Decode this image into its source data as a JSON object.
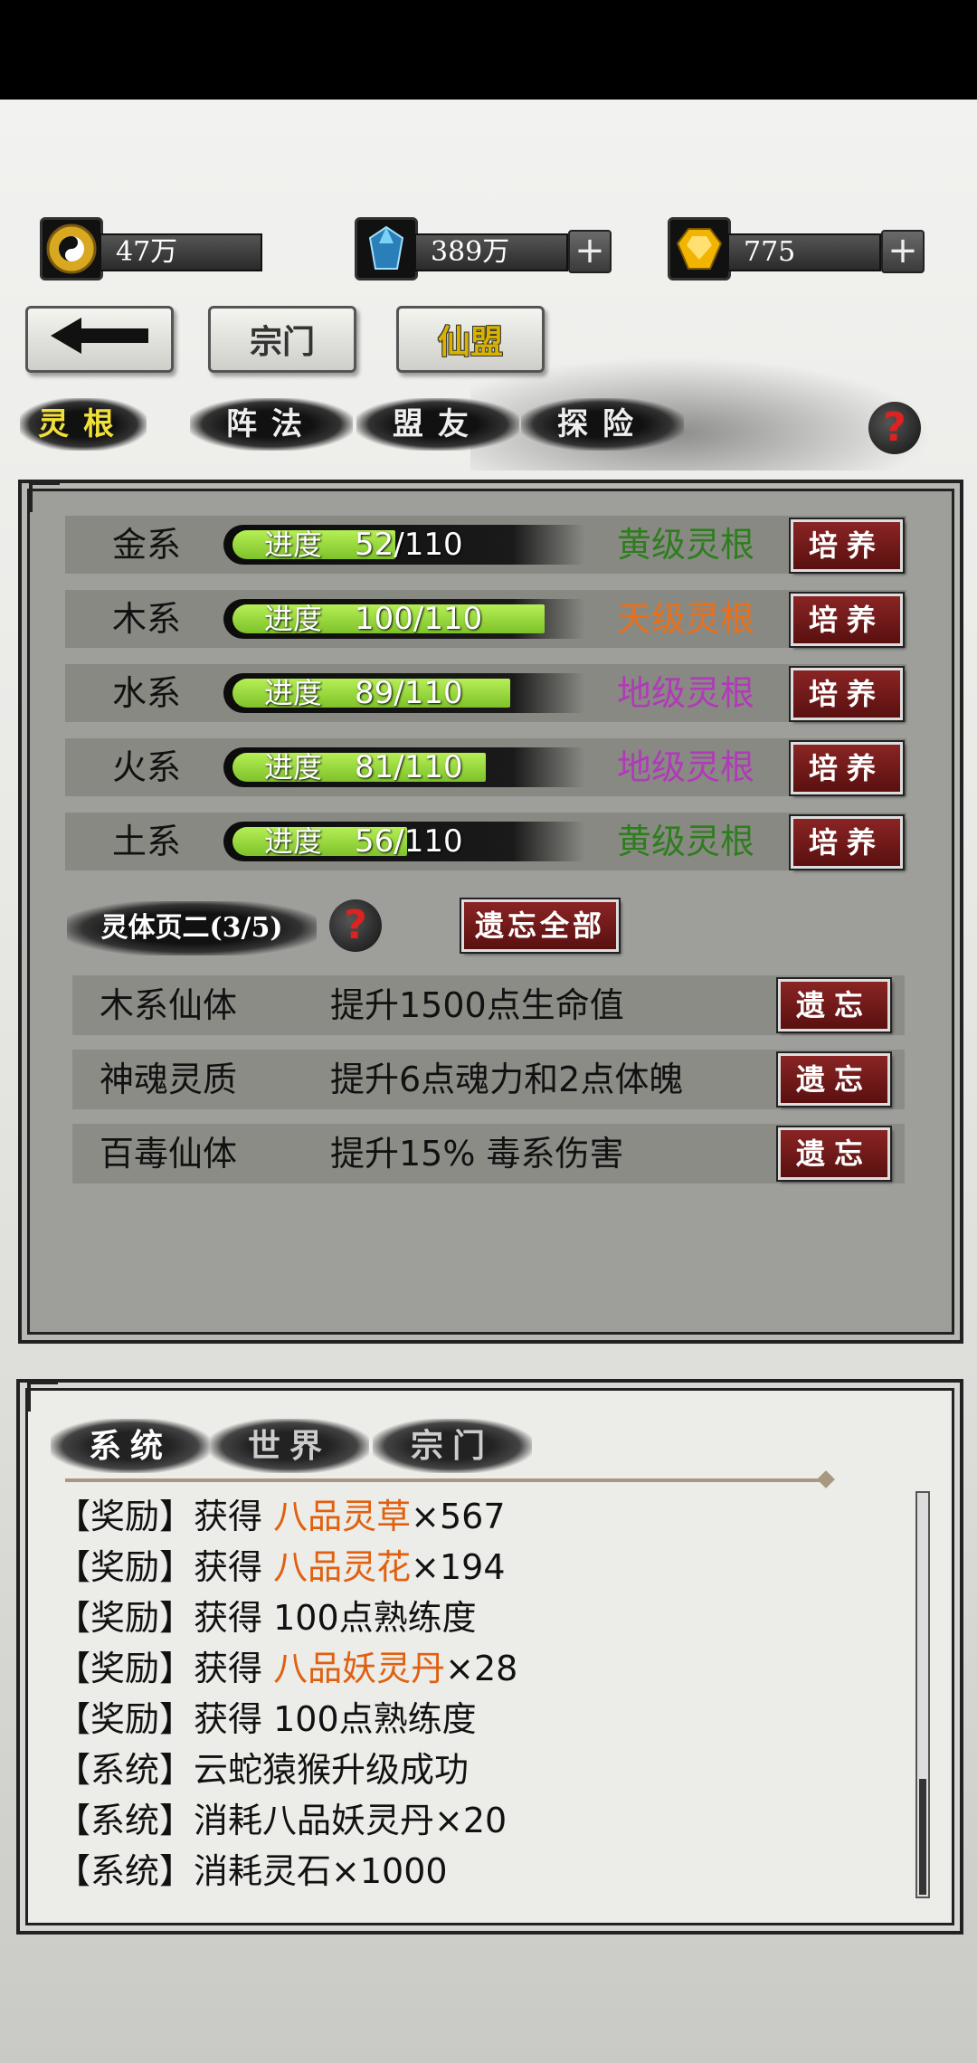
{
  "resources": [
    {
      "icon": "yin-yang-coin-icon",
      "value": "47万",
      "has_plus": false
    },
    {
      "icon": "blue-crystal-icon",
      "value": "389万",
      "has_plus": true
    },
    {
      "icon": "gold-gem-icon",
      "value": "775",
      "has_plus": true
    }
  ],
  "nav": {
    "back_icon": "back-arrow-icon",
    "sect": "宗门",
    "alliance": "仙盟"
  },
  "tabs": [
    "灵根",
    "阵法",
    "盟友",
    "探险"
  ],
  "spirit_roots": [
    {
      "element": "金系",
      "progress_label": "进度",
      "progress": "52/110",
      "current": 52,
      "max": 110,
      "grade": "黄级灵根",
      "grade_color": "#2e7d1e",
      "button": "培养"
    },
    {
      "element": "木系",
      "progress_label": "进度",
      "progress": "100/110",
      "current": 100,
      "max": 110,
      "grade": "天级灵根",
      "grade_color": "#e8701a",
      "button": "培养"
    },
    {
      "element": "水系",
      "progress_label": "进度",
      "progress": "89/110",
      "current": 89,
      "max": 110,
      "grade": "地级灵根",
      "grade_color": "#b03ab8",
      "button": "培养"
    },
    {
      "element": "火系",
      "progress_label": "进度",
      "progress": "81/110",
      "current": 81,
      "max": 110,
      "grade": "地级灵根",
      "grade_color": "#b03ab8",
      "button": "培养"
    },
    {
      "element": "土系",
      "progress_label": "进度",
      "progress": "56/110",
      "current": 56,
      "max": 110,
      "grade": "黄级灵根",
      "grade_color": "#2e7d1e",
      "button": "培养"
    }
  ],
  "body_section": {
    "title": "灵体页二(3/5)",
    "forget_all": "遗忘全部"
  },
  "traits": [
    {
      "name": "木系仙体",
      "desc": "提升1500点生命值",
      "button": "遗忘"
    },
    {
      "name": "神魂灵质",
      "desc": "提升6点魂力和2点体魄",
      "button": "遗忘"
    },
    {
      "name": "百毒仙体",
      "desc": "提升15% 毒系伤害",
      "button": "遗忘"
    }
  ],
  "log_tabs": [
    "系统",
    "世界",
    "宗门"
  ],
  "log": [
    {
      "tag": "【奖励】",
      "pre": "获得 ",
      "item": "八品灵草",
      "post": "×567"
    },
    {
      "tag": "【奖励】",
      "pre": "获得 ",
      "item": "八品灵花",
      "post": "×194"
    },
    {
      "tag": "【奖励】",
      "pre": "获得 100点熟练度",
      "item": "",
      "post": ""
    },
    {
      "tag": "【奖励】",
      "pre": "获得 ",
      "item": "八品妖灵丹",
      "post": "×28"
    },
    {
      "tag": "【奖励】",
      "pre": "获得 100点熟练度",
      "item": "",
      "post": ""
    },
    {
      "tag": "【系统】",
      "pre": "云蛇猿猴升级成功",
      "item": "",
      "post": ""
    },
    {
      "tag": "【系统】",
      "pre": "消耗八品妖灵丹×20",
      "item": "",
      "post": ""
    },
    {
      "tag": "【系统】",
      "pre": "消耗灵石×1000",
      "item": "",
      "post": ""
    }
  ],
  "colors": {
    "highlight": "#e06010",
    "progress_fill": "#8ed232",
    "button_red": "#7a1a1a"
  }
}
